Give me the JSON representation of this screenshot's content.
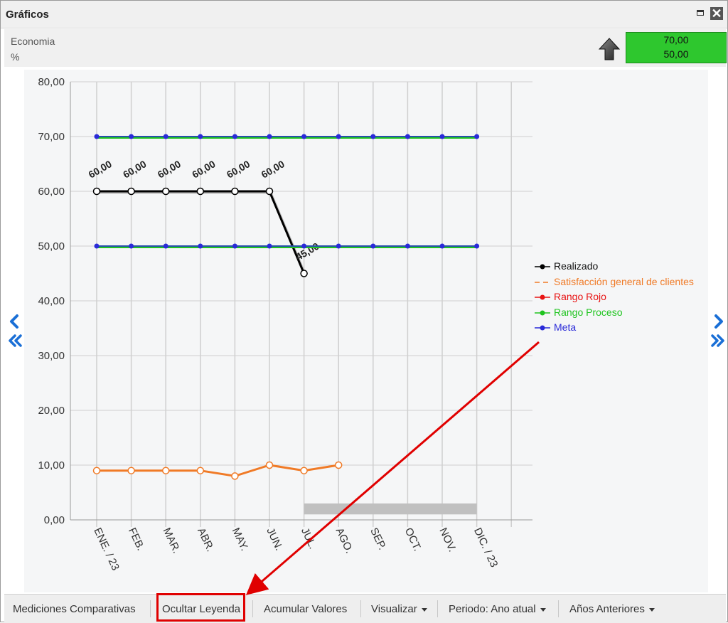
{
  "window": {
    "title": "Gráficos"
  },
  "header": {
    "indicator_name": "Economia",
    "unit": "%",
    "value_top": "70,00",
    "value_bottom": "50,00",
    "value_box_color": "#2ec72e",
    "trend_icon": "arrow-up-icon"
  },
  "legend": [
    {
      "label": "Realizado",
      "color": "#000000",
      "style": "line-dot"
    },
    {
      "label": "Satisfacción general de clientes",
      "color": "#f07a26",
      "style": "dashed"
    },
    {
      "label": "Rango Rojo",
      "color": "#e81414",
      "style": "line-dot"
    },
    {
      "label": "Rango Proceso",
      "color": "#1fc41f",
      "style": "line-dot"
    },
    {
      "label": "Meta",
      "color": "#2a2ad8",
      "style": "line-dot"
    }
  ],
  "chart_data": {
    "type": "line",
    "categories": [
      "ENE. / 23",
      "FEB.",
      "MAR.",
      "ABR.",
      "MAY.",
      "JUN.",
      "JUL.",
      "AGO.",
      "SEP.",
      "OCT.",
      "NOV.",
      "DIC. / 23"
    ],
    "ylim": [
      0,
      80
    ],
    "yticks": [
      "0,00",
      "10,00",
      "20,00",
      "30,00",
      "40,00",
      "50,00",
      "60,00",
      "70,00",
      "80,00"
    ],
    "grid": true,
    "legend_position": "right",
    "series": [
      {
        "name": "Realizado",
        "color": "#000000",
        "values": [
          60,
          60,
          60,
          60,
          60,
          60,
          45,
          null,
          null,
          null,
          null,
          null
        ],
        "labels": [
          "60,00",
          "60,00",
          "60,00",
          "60,00",
          "60,00",
          "60,00",
          "45,00"
        ]
      },
      {
        "name": "Satisfacción general de clientes",
        "color": "#f07a26",
        "values": [
          9,
          9,
          9,
          9,
          8,
          10,
          9,
          10,
          null,
          null,
          null,
          null
        ]
      },
      {
        "name": "Meta",
        "color": "#2a2ad8",
        "values": [
          70,
          70,
          70,
          70,
          70,
          70,
          70,
          70,
          70,
          70,
          70,
          70
        ]
      },
      {
        "name": "Meta",
        "color": "#2a2ad8",
        "values": [
          50,
          50,
          50,
          50,
          50,
          50,
          50,
          50,
          50,
          50,
          50,
          50
        ]
      }
    ],
    "band": {
      "color": "#c0c0c0",
      "from_category": "JUL.",
      "to_category": "DIC. / 23",
      "ymin": 1,
      "ymax": 3
    }
  },
  "toolbar": {
    "comparative": "Mediciones Comparativas",
    "hide_legend": "Ocultar Leyenda",
    "accumulate": "Acumular Valores",
    "view": "Visualizar",
    "period": "Periodo: Ano atual",
    "previous_years": "Años Anteriores"
  }
}
